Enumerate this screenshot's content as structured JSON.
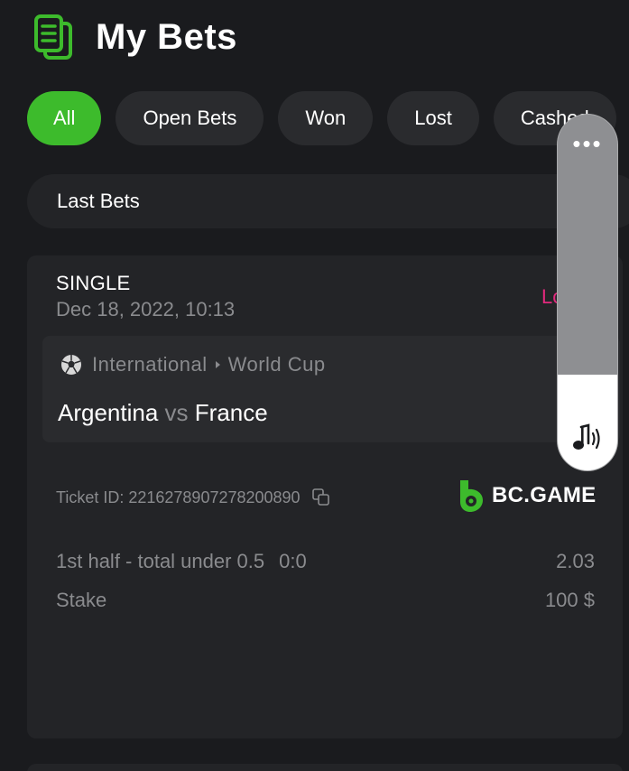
{
  "header": {
    "title": "My Bets",
    "icon": "bets-document-icon"
  },
  "tabs": [
    {
      "label": "All",
      "active": true
    },
    {
      "label": "Open Bets",
      "active": false
    },
    {
      "label": "Won",
      "active": false
    },
    {
      "label": "Lost",
      "active": false
    },
    {
      "label": "Cashed",
      "active": false
    }
  ],
  "filter": {
    "label": "Last Bets"
  },
  "bet": {
    "type": "SINGLE",
    "date": "Dec 18, 2022, 10:13",
    "status": "Lost",
    "match": {
      "category": "International",
      "league": "World Cup",
      "home": "Argentina",
      "vs": "vs",
      "away": "France"
    },
    "ticket_label": "Ticket ID:",
    "ticket_id": "2216278907278200890",
    "brand": "BC.GAME",
    "selection": "1st half - total under 0.5",
    "score": "0:0",
    "odds": "2.03",
    "stake_label": "Stake",
    "stake_value": "100 $"
  },
  "volume": {
    "level": 0.27,
    "dots": "•••"
  },
  "colors": {
    "background": "#1a1b1e",
    "card": "#232427",
    "accent_green": "#3dbb2c",
    "lost_pink": "#e2297d",
    "muted_text": "#8a8b8e"
  }
}
